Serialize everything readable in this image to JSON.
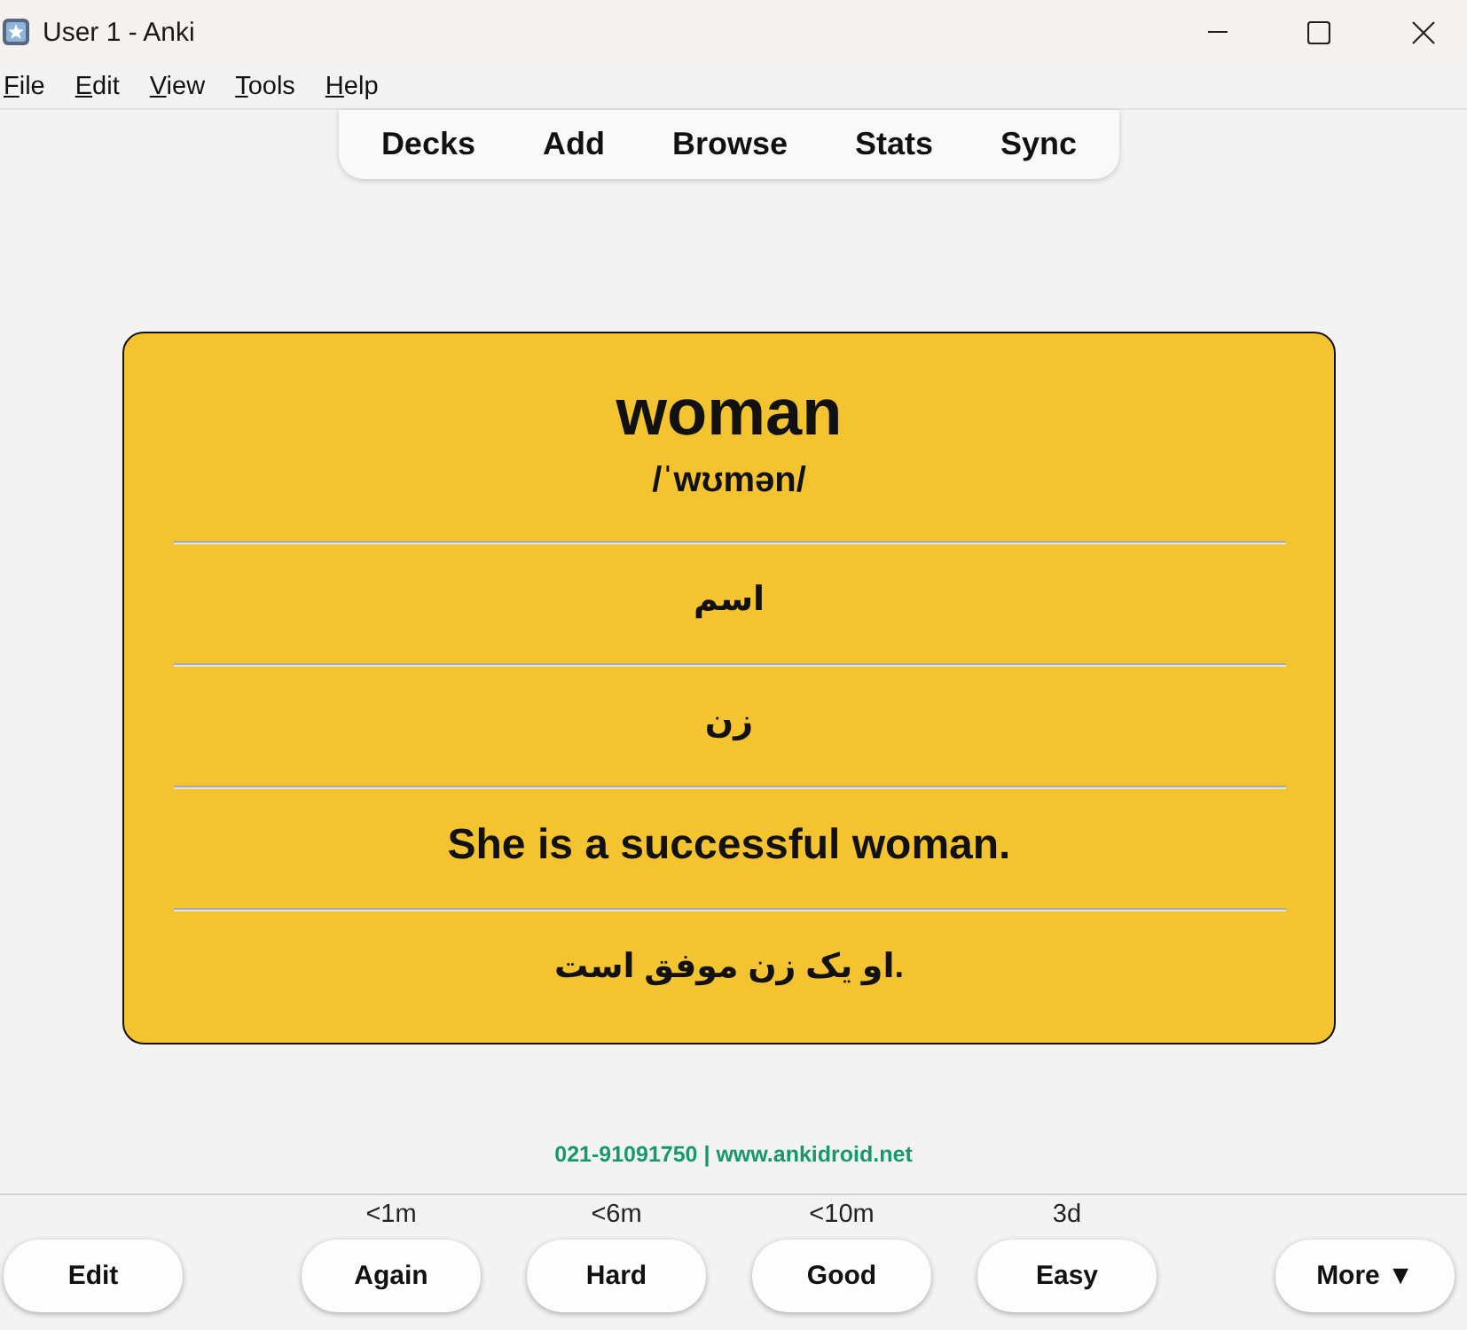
{
  "window": {
    "title": "User 1 - Anki"
  },
  "menu_bar": [
    "File",
    "Edit",
    "View",
    "Tools",
    "Help"
  ],
  "toolbar": [
    "Decks",
    "Add",
    "Browse",
    "Stats",
    "Sync"
  ],
  "card": {
    "word": "woman",
    "pronunciation": "/ˈwʊmən/",
    "fields": [
      {
        "kind": "persian",
        "text": "اسم"
      },
      {
        "kind": "persian",
        "text": "زن"
      },
      {
        "kind": "english",
        "text": "She is a successful woman."
      },
      {
        "kind": "persian",
        "text": "او یک زن موفق است."
      }
    ]
  },
  "footer": "021-91091750 | www.ankidroid.net",
  "answer_bar": {
    "edit_button": "Edit",
    "answers": [
      {
        "label": "Again",
        "interval": "<1m"
      },
      {
        "label": "Hard",
        "interval": "<6m"
      },
      {
        "label": "Good",
        "interval": "<10m"
      },
      {
        "label": "Easy",
        "interval": "3d"
      }
    ],
    "more_button": "More ▼"
  }
}
